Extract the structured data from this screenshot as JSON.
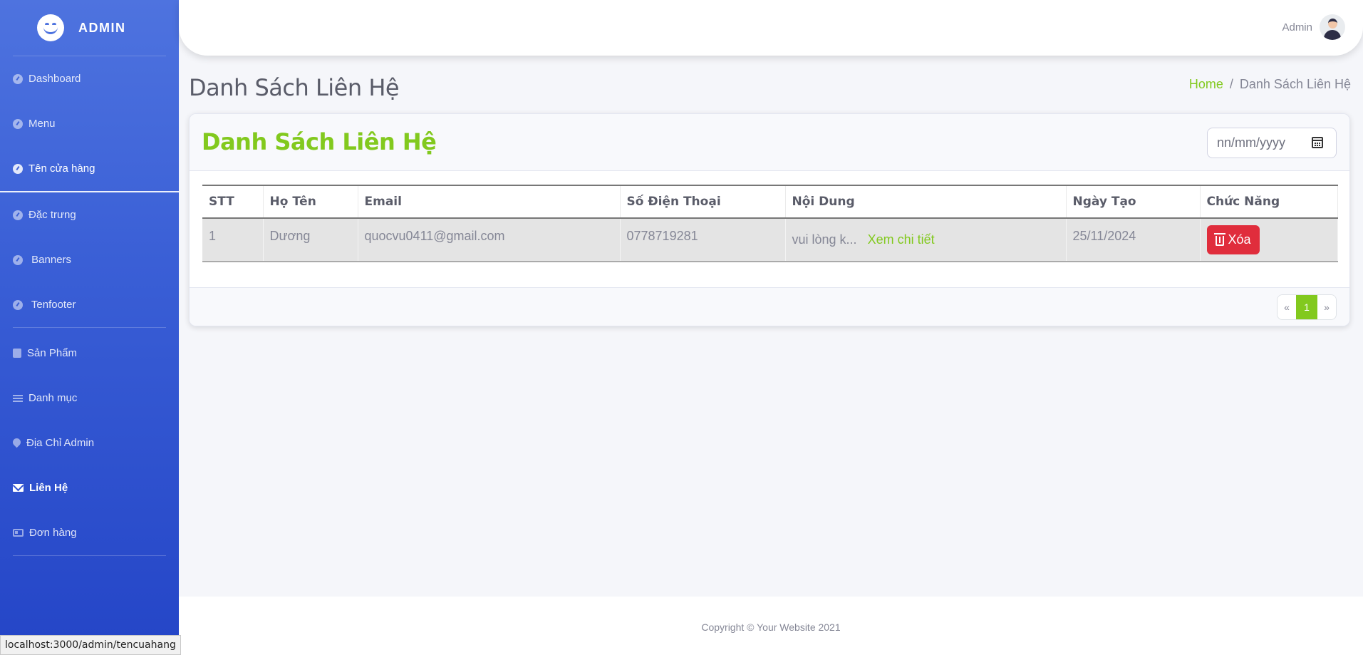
{
  "sidebar": {
    "brand": "ADMIN",
    "items": [
      {
        "label": "Dashboard"
      },
      {
        "label": "Menu"
      },
      {
        "label": "Tên cửa hàng"
      },
      {
        "label": "Đặc trưng"
      },
      {
        "label": " Banners"
      },
      {
        "label": " Tenfooter"
      },
      {
        "label": "Sản Phẩm"
      },
      {
        "label": "Danh mục"
      },
      {
        "label": "Địa Chỉ Admin"
      },
      {
        "label": "Liên Hệ"
      },
      {
        "label": "Đơn hàng"
      }
    ],
    "active_item": "Liên Hệ"
  },
  "topbar": {
    "user_name": "Admin"
  },
  "page": {
    "title": "Danh Sách Liên Hệ",
    "breadcrumb": {
      "home": "Home",
      "separator": "/",
      "current": "Danh Sách Liên Hệ"
    }
  },
  "card": {
    "title": "Danh Sách Liên Hệ",
    "date_placeholder": "nn/mm/yyyy"
  },
  "table": {
    "headers": [
      "STT",
      "Họ Tên",
      "Email",
      "Số Điện Thoại",
      "Nội Dung",
      "Ngày Tạo",
      "Chức Năng"
    ],
    "rows": [
      {
        "stt": "1",
        "name": "Dương",
        "email": "quocvu0411@gmail.com",
        "phone": "0778719281",
        "content": "vui lòng k...",
        "view_label": "Xem chi tiết",
        "created": "25/11/2024",
        "delete_label": "Xóa"
      }
    ]
  },
  "pagination": {
    "prev": "«",
    "current": "1",
    "next": "»"
  },
  "footer": {
    "copyright": "Copyright © Your Website 2021"
  },
  "status_bar": {
    "url": "localhost:3000/admin/tencuahang"
  },
  "colors": {
    "accent_green": "#82c91e",
    "sidebar_blue": "#4e73df",
    "danger": "#e02d3c"
  }
}
